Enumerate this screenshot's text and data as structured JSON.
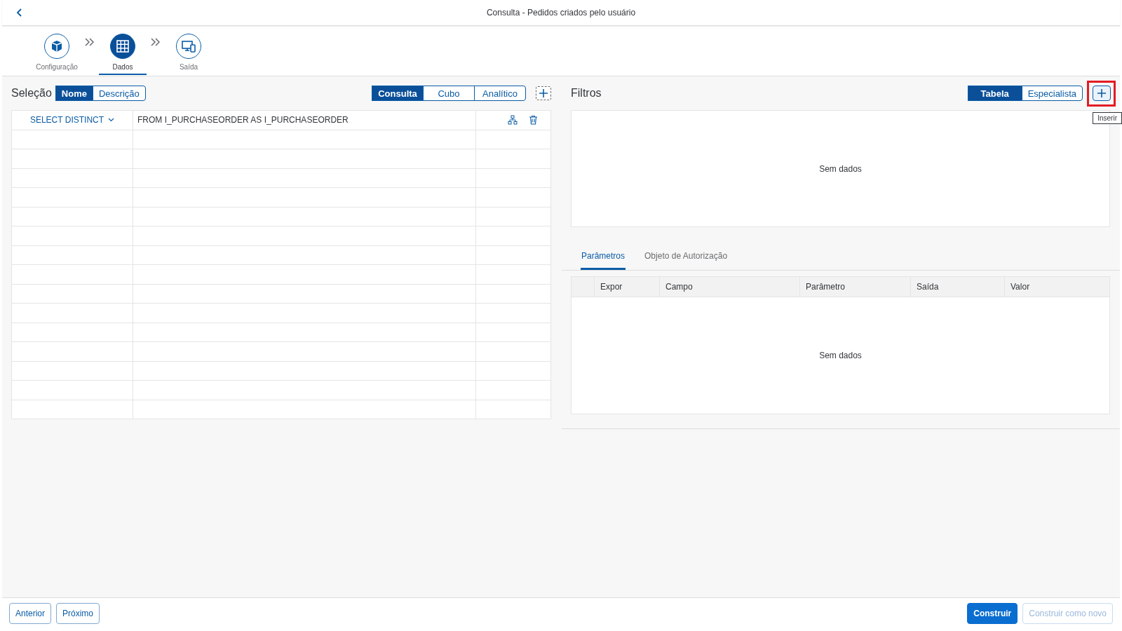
{
  "header": {
    "title": "Consulta - Pedidos criados pelo usuário"
  },
  "steps": [
    {
      "label": "Configuração",
      "selected": false
    },
    {
      "label": "Dados",
      "selected": true
    },
    {
      "label": "Saída",
      "selected": false
    }
  ],
  "selection": {
    "title": "Seleção",
    "view_toggle": [
      {
        "label": "Nome",
        "selected": true
      },
      {
        "label": "Descrição",
        "selected": false
      }
    ],
    "source_toggle": [
      {
        "label": "Consulta",
        "selected": true
      },
      {
        "label": "Cubo",
        "selected": false
      },
      {
        "label": "Analítico",
        "selected": false
      }
    ],
    "rows": [
      {
        "select": "SELECT DISTINCT",
        "from": "FROM I_PURCHASEORDER AS I_PURCHASEORDER"
      }
    ]
  },
  "filters": {
    "title": "Filtros",
    "mode_toggle": [
      {
        "label": "Tabela",
        "selected": true
      },
      {
        "label": "Especialista",
        "selected": false
      }
    ],
    "add_tooltip": "Inserir",
    "add_highlighted": true,
    "empty_text": "Sem dados"
  },
  "tabs": [
    {
      "label": "Parâmetros",
      "selected": true
    },
    {
      "label": "Objeto de Autorização",
      "selected": false
    }
  ],
  "parameters": {
    "columns": [
      "Expor",
      "Campo",
      "Parâmetro",
      "Saída",
      "Valor"
    ],
    "empty_text": "Sem dados"
  },
  "footer": {
    "left_buttons": [
      {
        "label": "Anterior"
      },
      {
        "label": "Próximo"
      }
    ],
    "right_buttons": [
      {
        "label": "Construir",
        "kind": "emphasized",
        "disabled": false
      },
      {
        "label": "Construir como novo",
        "kind": "default",
        "disabled": true
      }
    ]
  }
}
